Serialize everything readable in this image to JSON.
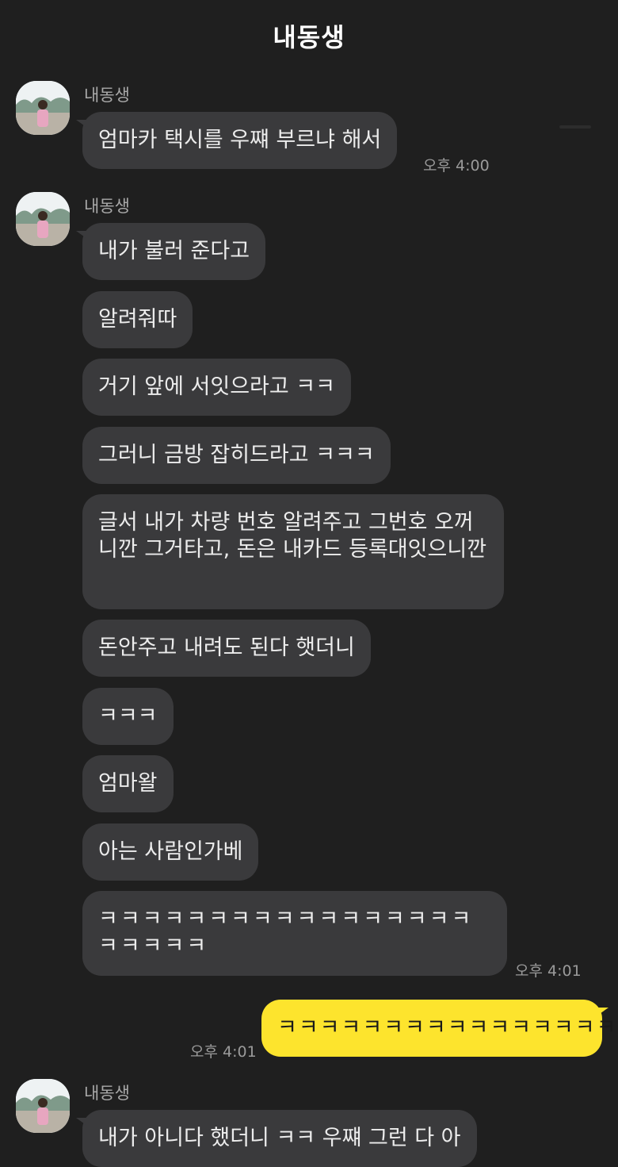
{
  "header": {
    "title": "내동생"
  },
  "groups": [
    {
      "sender": "내동생",
      "messages": [
        "엄마카 택시를 우쨰 부르냐 해서"
      ],
      "time": "오후 4:00"
    },
    {
      "sender": "내동생",
      "messages": [
        "내가 불러 준다고",
        "알려줘따",
        "거기 앞에 서잇으라고 ㅋㅋ",
        "그러니 금방 잡히드라고 ㅋㅋㅋ",
        "글서 내가 차량 번호 알려주고 그번호 오꺼니깐 그거타고, 돈은 내카드 등록대잇으니깐",
        "돈안주고 내려도 된다 햇더니",
        "ㅋㅋㅋ",
        "엄마왈",
        "아는 사람인가베",
        "ㅋㅋㅋㅋㅋㅋㅋㅋㅋㅋㅋㅋㅋㅋㅋㅋㅋㅋㅋㅋㅋㅋ"
      ],
      "time": "오후 4:01"
    },
    {
      "sender": "내동생",
      "messages": [
        "내가 아니다 했더니 ㅋㅋ 우쨰 그런 다 아"
      ]
    }
  ],
  "my_message": {
    "text": "ㅋㅋㅋㅋㅋㅋㅋㅋㅋㅋㅋㅋㅋㅋㅋㅋ",
    "time": "오후 4:01"
  },
  "colors": {
    "background": "#1f1f1f",
    "their_bubble": "#3a3a3c",
    "my_bubble": "#fde42d"
  },
  "icons": {
    "avatar": "profile-photo"
  }
}
